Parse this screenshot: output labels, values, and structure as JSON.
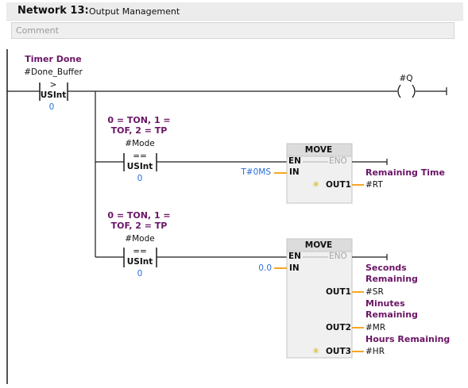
{
  "network": {
    "title": "Network 13:",
    "name": "Output Management",
    "comment_placeholder": "Comment"
  },
  "rung1": {
    "comparator": {
      "comment": "Timer Done",
      "operand": "#Done_Buffer",
      "op": ">",
      "type": "USInt",
      "value": "0"
    },
    "coil": {
      "operand": "#Q",
      "symbol": "( )"
    }
  },
  "rung2": {
    "comparator": {
      "comment_line1": "0 = TON, 1 =",
      "comment_line2": "TOF, 2 = TP",
      "operand": "#Mode",
      "op": "==",
      "type": "USInt",
      "value": "0"
    },
    "move": {
      "title": "MOVE",
      "en": "EN",
      "eno": "ENO",
      "in_label": "IN",
      "in_value": "T#0MS",
      "outputs": [
        {
          "label": "OUT1",
          "var": "#RT",
          "comment": "Remaining Time",
          "star": true
        }
      ]
    }
  },
  "rung3": {
    "comparator": {
      "comment_line1": "0 = TON, 1 =",
      "comment_line2": "TOF, 2 = TP",
      "operand": "#Mode",
      "op": "==",
      "type": "USInt",
      "value": "0"
    },
    "move": {
      "title": "MOVE",
      "en": "EN",
      "eno": "ENO",
      "in_label": "IN",
      "in_value": "0.0",
      "outputs": [
        {
          "label": "OUT1",
          "var": "#SR",
          "comment_line1": "Seconds",
          "comment_line2": "Remaining",
          "star": false
        },
        {
          "label": "OUT2",
          "var": "#MR",
          "comment_line1": "Minutes",
          "comment_line2": "Remaining",
          "star": false
        },
        {
          "label": "OUT3",
          "var": "#HR",
          "comment": "Hours Remaining",
          "star": true
        }
      ]
    }
  },
  "colors": {
    "wire": "#1a1a1a",
    "orange": "#f5a623",
    "box_fill": "#f0f0f0",
    "box_title": "#dcdcdc",
    "purple": "#6b1466",
    "blue": "#2a6ed8"
  }
}
